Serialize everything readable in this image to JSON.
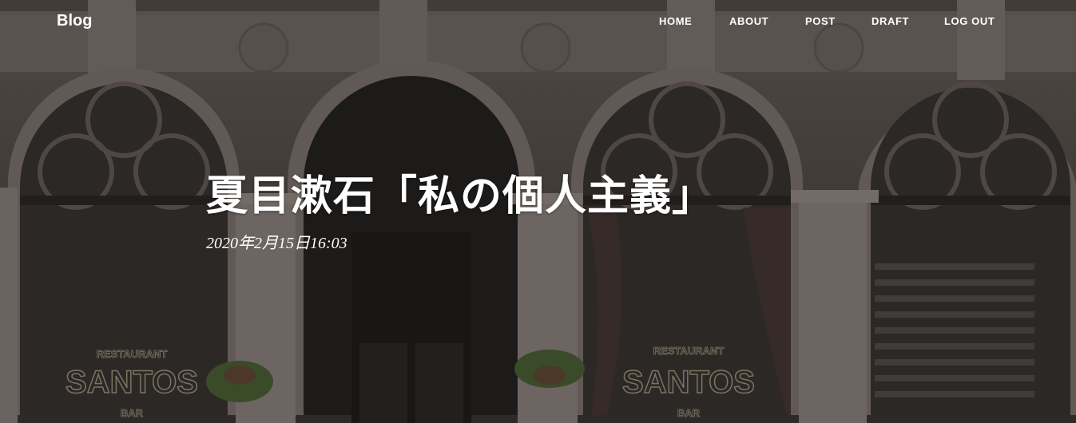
{
  "brand": "Blog",
  "nav": {
    "home": "HOME",
    "about": "ABOUT",
    "post": "POST",
    "draft": "DRAFT",
    "logout": "LOG OUT"
  },
  "post": {
    "title": "夏目漱石「私の個人主義」",
    "date": "2020年2月15日",
    "time": "16:03"
  },
  "background_signs": {
    "left_top": "RESTAURANT",
    "left_main": "SANTOS",
    "left_bottom": "BAR",
    "right_top": "RESTAURANT",
    "right_main": "SANTOS",
    "right_bottom": "BAR"
  },
  "colors": {
    "nav_text": "#ffffff",
    "title_text": "#ffffff",
    "facade_stone": "#8a807c"
  }
}
